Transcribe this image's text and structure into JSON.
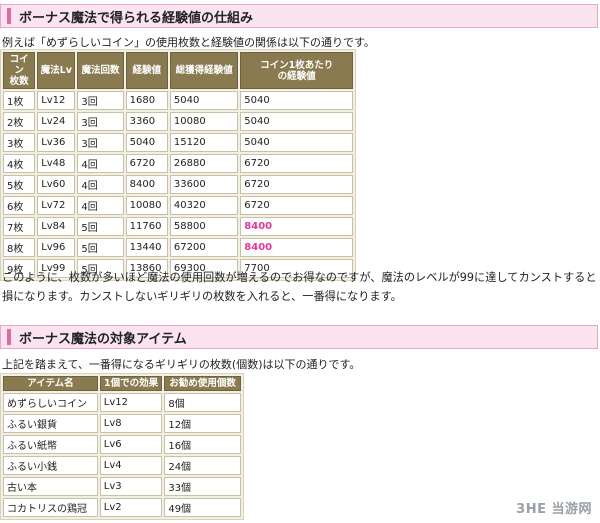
{
  "section1": {
    "title": "ボーナス魔法で得られる経験値の仕組み",
    "intro": "例えば「めずらしいコイン」の使用枚数と経験値の関係は以下の通りです。",
    "headers": [
      "コイン\n枚数",
      "魔法Lv",
      "魔法回数",
      "経験値",
      "総獲得経験値",
      "コイン1枚あたり\nの経験値"
    ],
    "rows": [
      [
        "1枚",
        "Lv12",
        "3回",
        "1680",
        "5040",
        "5040"
      ],
      [
        "2枚",
        "Lv24",
        "3回",
        "3360",
        "10080",
        "5040"
      ],
      [
        "3枚",
        "Lv36",
        "3回",
        "5040",
        "15120",
        "5040"
      ],
      [
        "4枚",
        "Lv48",
        "4回",
        "6720",
        "26880",
        "6720"
      ],
      [
        "5枚",
        "Lv60",
        "4回",
        "8400",
        "33600",
        "6720"
      ],
      [
        "6枚",
        "Lv72",
        "4回",
        "10080",
        "40320",
        "6720"
      ],
      [
        "7枚",
        "Lv84",
        "5回",
        "11760",
        "58800",
        "8400"
      ],
      [
        "8枚",
        "Lv96",
        "5回",
        "13440",
        "67200",
        "8400"
      ],
      [
        "9枚",
        "Lv99",
        "5回",
        "13860",
        "69300",
        "7700"
      ]
    ],
    "highlight_color": "#e0399b",
    "paragraph": "このように、枚数が多いほど魔法の使用回数が増えるのでお得なのですが、魔法のレベルが99に達してカンストすると損になります。カンストしないギリギリの枚数を入れると、一番得になります。"
  },
  "section2": {
    "title": "ボーナス魔法の対象アイテム",
    "intro": "上記を踏まえて、一番得になるギリギリの枚数(個数)は以下の通りです。",
    "headers": [
      "アイテム名",
      "1個での効果",
      "お勧め使用個数"
    ],
    "rows": [
      [
        "めずらしいコイン",
        "Lv12",
        "8個"
      ],
      [
        "ふるい銀貨",
        "Lv8",
        "12個"
      ],
      [
        "ふるい紙幣",
        "Lv6",
        "16個"
      ],
      [
        "ふるい小銭",
        "Lv4",
        "24個"
      ],
      [
        "古い本",
        "Lv3",
        "33個"
      ],
      [
        "コカトリスの鶏冠",
        "Lv2",
        "49個"
      ]
    ]
  },
  "watermark": "3HE 当游网"
}
